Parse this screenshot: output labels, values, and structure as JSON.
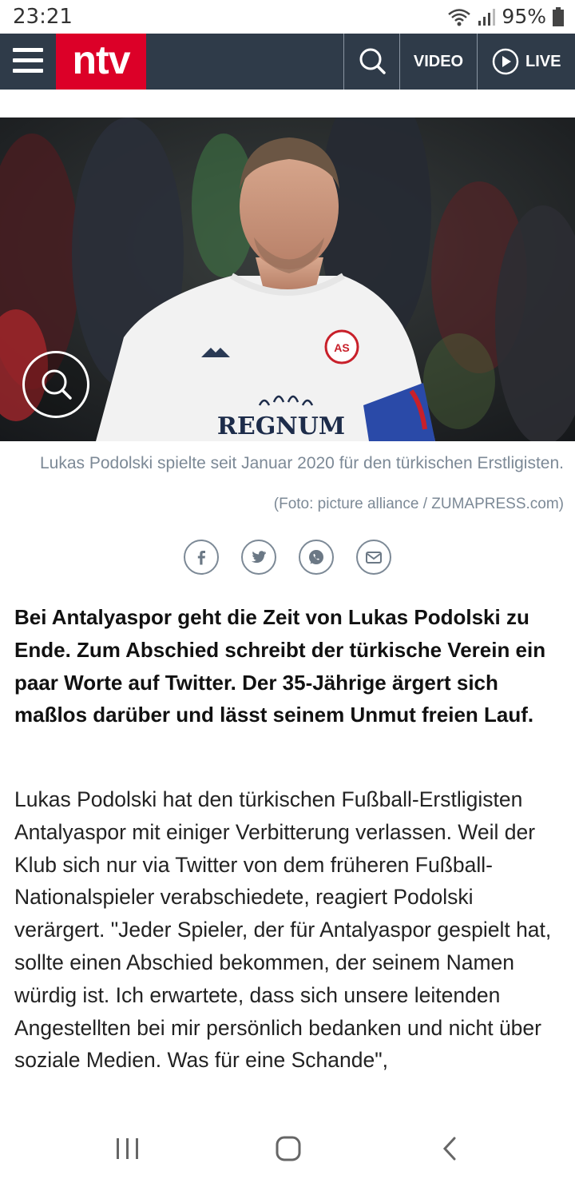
{
  "status_bar": {
    "time": "23:21",
    "battery": "95%",
    "icons": [
      "wifi-icon",
      "signal-icon",
      "battery-icon"
    ]
  },
  "header": {
    "logo": "ntv",
    "search_icon": "search-icon",
    "video_label": "VIDEO",
    "live_label": "LIVE",
    "colors": {
      "bar": "#2f3b49",
      "logo": "#dc0028"
    }
  },
  "hero": {
    "jersey_text": "REGNUM",
    "zoom_icon": "magnifier-icon"
  },
  "caption": {
    "text": "Lukas Podolski spielte seit Januar 2020 für den türkischen Erstligisten.",
    "credit": "(Foto: picture alliance / ZUMAPRESS.com)"
  },
  "share": [
    "facebook-icon",
    "twitter-icon",
    "whatsapp-icon",
    "mail-icon"
  ],
  "article": {
    "lead": "Bei Antalyaspor geht die Zeit von Lukas Podolski zu Ende. Zum Abschied schreibt der türkische Verein ein paar Worte auf Twitter. Der 35-Jährige ärgert sich maßlos darüber und lässt seinem Unmut freien Lauf.",
    "body": "Lukas Podolski hat den türkischen Fußball-Erstligisten Antalyaspor mit einiger Verbitterung verlassen. Weil der Klub sich nur via Twitter von dem früheren Fußball-Nationalspieler verabschiedete, reagiert Podolski verärgert. \"Jeder Spieler, der für Antalyaspor gespielt hat, sollte einen Abschied bekommen, der seinem Namen würdig ist. Ich erwartete, dass sich unsere leitenden Angestellten bei mir persönlich bedanken und nicht über soziale Medien. Was für eine Schande\","
  },
  "navbar": [
    "recents-icon",
    "home-icon",
    "back-icon"
  ]
}
